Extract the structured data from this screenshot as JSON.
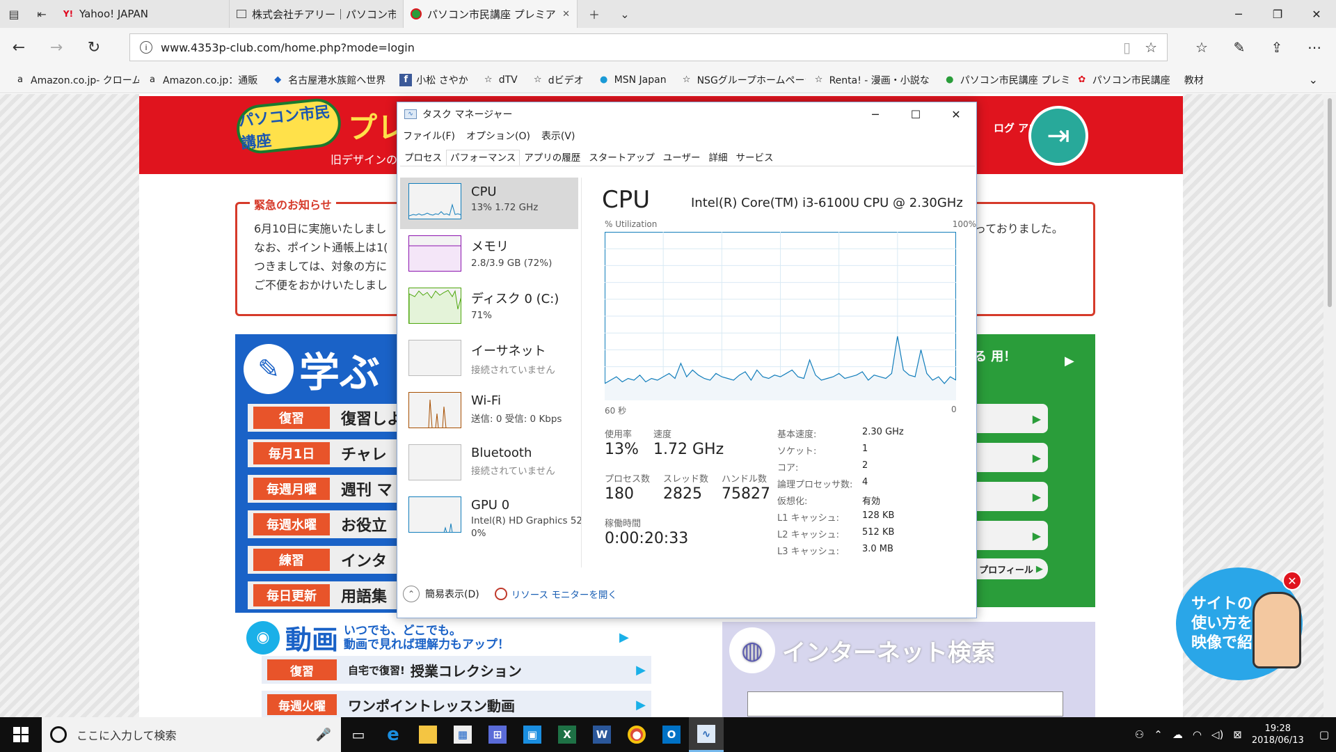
{
  "browser": {
    "tabs": [
      {
        "label": "Yahoo! JAPAN",
        "icon": "Y!"
      },
      {
        "label": "株式会社チアリー｜パソコン市民",
        "icon": ""
      },
      {
        "label": "パソコン市民講座 プレミア",
        "icon": ""
      }
    ],
    "url": "www.4353p-club.com/home.php?mode=login",
    "favorites": [
      {
        "label": "Amazon.co.jp- クローム",
        "icon": "a"
      },
      {
        "label": "Amazon.co.jp：通販",
        "icon": "a"
      },
      {
        "label": "名古屋港水族館へ世界",
        "icon": "◆"
      },
      {
        "label": "小松 さやか",
        "icon": "f"
      },
      {
        "label": "dTV",
        "icon": "☆"
      },
      {
        "label": "dビデオ",
        "icon": "☆"
      },
      {
        "label": "MSN Japan",
        "icon": "●"
      },
      {
        "label": "NSGグループホームページ",
        "icon": "☆"
      },
      {
        "label": "Renta! - 漫画・小説な",
        "icon": "☆"
      },
      {
        "label": "パソコン市民講座 プレミ",
        "icon": "●"
      },
      {
        "label": "パソコン市民講座",
        "icon": "✿"
      },
      {
        "label": "教材",
        "icon": ""
      }
    ]
  },
  "site": {
    "logo": "パソコン市民講座",
    "premium": "プレミ",
    "old_design": "旧デザインの",
    "logout": "ログ アウト",
    "notice": {
      "title": "緊急のお知らせ",
      "lines": [
        "6月10日に実施いたしまし",
        "なお、ポイント通帳上は1(",
        "つきましては、対象の方に",
        "ご不便をおかけいたしまし"
      ],
      "right_text": "っておりました。"
    },
    "learn": {
      "title": "学ぶ",
      "rows": [
        {
          "badge": "復習",
          "text": "復習しよ"
        },
        {
          "badge": "毎月1日",
          "text": "チャレ"
        },
        {
          "badge": "毎週月曜",
          "text": "週刊 マ"
        },
        {
          "badge": "毎週水曜",
          "text": "お役立"
        },
        {
          "badge": "練習",
          "text": "インタ"
        },
        {
          "badge": "毎日更新",
          "text": "用語集"
        }
      ],
      "video_title": "動画",
      "video_sub1": "いつでも、どこでも。",
      "video_sub2": "動画で見れば理解力もアップ！",
      "video_rows": [
        {
          "badge": "復習",
          "pre": "自宅で復習!",
          "text": "授業コレクション"
        },
        {
          "badge": "毎週火曜",
          "pre": "",
          "text": "ワンポイントレッスン動画"
        }
      ]
    },
    "green": {
      "text": "る 用！",
      "profile": "プロフィール"
    },
    "search_title": "インターネット検索",
    "promo": "サイトの 使い方を 映像で紹介"
  },
  "taskmanager": {
    "title": "タスク マネージャー",
    "menu": [
      "ファイル(F)",
      "オプション(O)",
      "表示(V)"
    ],
    "tabs": [
      "プロセス",
      "パフォーマンス",
      "アプリの履歴",
      "スタートアップ",
      "ユーザー",
      "詳細",
      "サービス"
    ],
    "active_tab": "パフォーマンス",
    "resources": [
      {
        "name": "CPU",
        "value": "13%  1.72 GHz",
        "color": "#117dbb"
      },
      {
        "name": "メモリ",
        "value": "2.8/3.9 GB (72%)",
        "color": "#8b12ae"
      },
      {
        "name": "ディスク 0 (C:)",
        "value": "71%",
        "color": "#4da60c"
      },
      {
        "name": "イーサネット",
        "value": "接続されていません",
        "color": "#a74f01"
      },
      {
        "name": "Wi-Fi",
        "value": "送信: 0  受信: 0 Kbps",
        "color": "#a74f01"
      },
      {
        "name": "Bluetooth",
        "value": "接続されていません",
        "color": "#a74f01"
      },
      {
        "name": "GPU 0",
        "value": "Intel(R) HD Graphics 52",
        "value2": "0%",
        "color": "#117dbb"
      }
    ],
    "cpu": {
      "title": "CPU",
      "model": "Intel(R) Core(TM) i3-6100U CPU @ 2.30GHz",
      "util_label": "% Utilization",
      "util_max": "100%",
      "x_left": "60 秒",
      "x_right": "0",
      "stats": {
        "usage_label": "使用率",
        "usage": "13%",
        "speed_label": "速度",
        "speed": "1.72 GHz",
        "proc_label": "プロセス数",
        "proc": "180",
        "thread_label": "スレッド数",
        "thread": "2825",
        "handle_label": "ハンドル数",
        "handle": "75827",
        "uptime_label": "稼働時間",
        "uptime": "0:00:20:33"
      },
      "details": [
        {
          "label": "基本速度:",
          "value": "2.30 GHz"
        },
        {
          "label": "ソケット:",
          "value": "1"
        },
        {
          "label": "コア:",
          "value": "2"
        },
        {
          "label": "論理プロセッサ数:",
          "value": "4"
        },
        {
          "label": "仮想化:",
          "value": "有効"
        },
        {
          "label": "L1 キャッシュ:",
          "value": "128 KB"
        },
        {
          "label": "L2 キャッシュ:",
          "value": "512 KB"
        },
        {
          "label": "L3 キャッシュ:",
          "value": "3.0 MB"
        }
      ]
    },
    "footer": {
      "simple": "簡易表示(D)",
      "resmon": "リソース モニターを開く"
    }
  },
  "chart_data": {
    "type": "area",
    "xlim": [
      60,
      0
    ],
    "ylim": [
      0,
      100
    ],
    "x": [
      60,
      59,
      58,
      57,
      56,
      55,
      54,
      53,
      52,
      51,
      50,
      49,
      48,
      47,
      46,
      45,
      44,
      43,
      42,
      41,
      40,
      39,
      38,
      37,
      36,
      35,
      34,
      33,
      32,
      31,
      30,
      29,
      28,
      27,
      26,
      25,
      24,
      23,
      22,
      21,
      20,
      19,
      18,
      17,
      16,
      15,
      14,
      13,
      12,
      11,
      10,
      9,
      8,
      7,
      6,
      5,
      4,
      3,
      2,
      1,
      0
    ],
    "values": [
      10,
      12,
      14,
      11,
      13,
      12,
      15,
      11,
      13,
      12,
      14,
      16,
      13,
      22,
      14,
      18,
      15,
      13,
      12,
      16,
      14,
      13,
      12,
      15,
      17,
      12,
      18,
      14,
      13,
      15,
      14,
      16,
      18,
      14,
      13,
      24,
      15,
      12,
      13,
      14,
      16,
      13,
      14,
      15,
      17,
      12,
      15,
      14,
      13,
      16,
      38,
      18,
      15,
      14,
      30,
      16,
      12,
      14,
      10,
      14,
      12
    ],
    "title": "CPU",
    "ylabel": "% Utilization",
    "grid": true
  },
  "taskbar": {
    "search_placeholder": "ここに入力して検索",
    "time": "19:28",
    "date": "2018/06/13"
  }
}
